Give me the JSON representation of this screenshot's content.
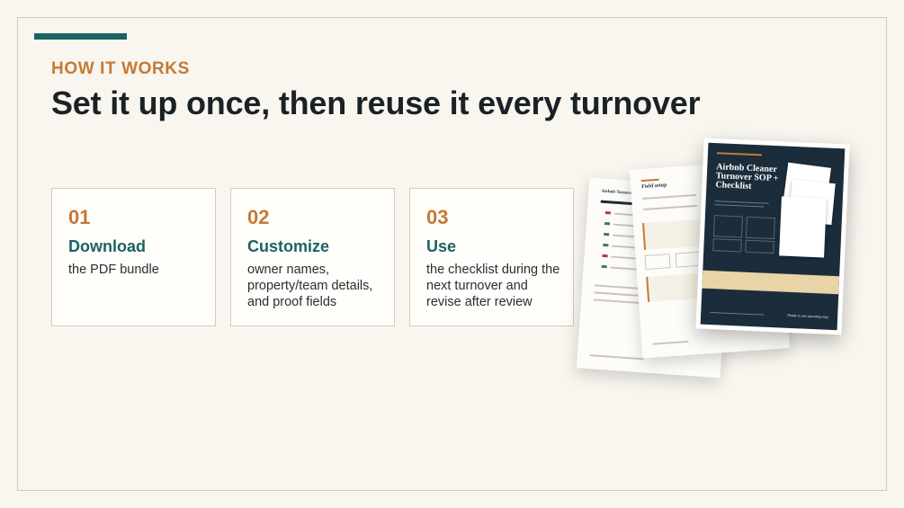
{
  "eyebrow": "HOW IT WORKS",
  "headline": "Set it up once, then reuse it every turnover",
  "steps": [
    {
      "num": "01",
      "title": "Download",
      "desc": "the PDF bundle"
    },
    {
      "num": "02",
      "title": "Customize",
      "desc": "owner names, property/team details, and proof fields"
    },
    {
      "num": "03",
      "title": "Use",
      "desc": "the checklist during the next turnover and revise after review"
    }
  ],
  "preview": {
    "back_page_title": "Airbnb Turnover",
    "middle_page_title": "Field setup",
    "cover_title": "Airbnb Cleaner Turnover SOP + Checklist",
    "cover_footer_right": "Ready to use operating copy"
  },
  "colors": {
    "accent": "#1a6462",
    "eyebrow": "#c47a35",
    "frame": "#d6cbbb",
    "background": "#f8f6ef",
    "cover": "#1b2d3b"
  }
}
